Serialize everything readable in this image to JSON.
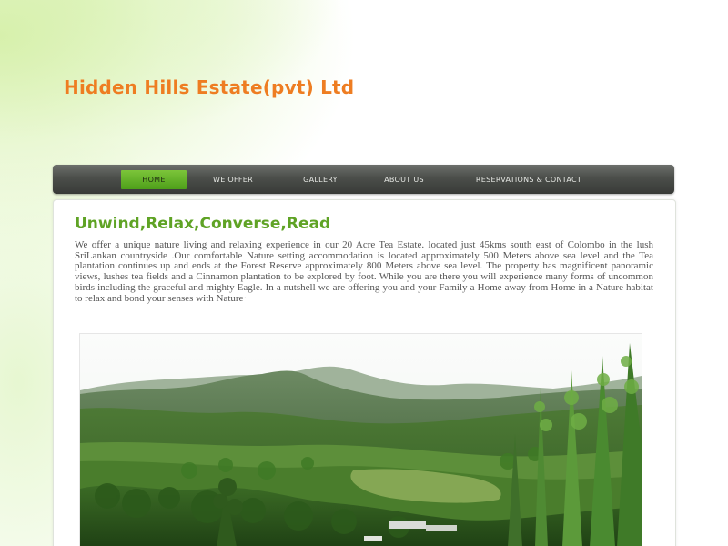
{
  "site": {
    "title": "Hidden Hills Estate(pvt) Ltd"
  },
  "nav": {
    "items": [
      {
        "label": "HOME",
        "active": true
      },
      {
        "label": "WE OFFER",
        "active": false
      },
      {
        "label": "GALLERY",
        "active": false
      },
      {
        "label": "ABOUT US",
        "active": false
      },
      {
        "label": "RESERVATIONS & CONTACT",
        "active": false
      }
    ]
  },
  "main": {
    "heading": "Unwind,Relax,Converse,Read",
    "intro": "We offer a unique nature living and relaxing experience in our 20 Acre Tea Estate. located just 45kms south east of Colombo in the lush SriLankan countryside .Our comfortable Nature setting accommodation is located approximately 500 Meters above sea level and the Tea plantation continues up and ends at the Forest Reserve approximately 800 Meters above sea level. The property has magnificent panoramic views, lushes tea fields and a Cinnamon plantation to be explored by foot. While you are there you will experience many forms of uncommon birds including the graceful and mighty Eagle. In a nutshell we are offering you and your Family  a Home away from Home in a Nature habitat to relax and bond your senses with Nature·"
  },
  "colors": {
    "title": "#ee7d22",
    "heading": "#5fa325",
    "nav_bar": "#4b4e4a",
    "nav_active": "#5fb02a"
  },
  "icons": {
    "photo": "landscape-photo"
  }
}
